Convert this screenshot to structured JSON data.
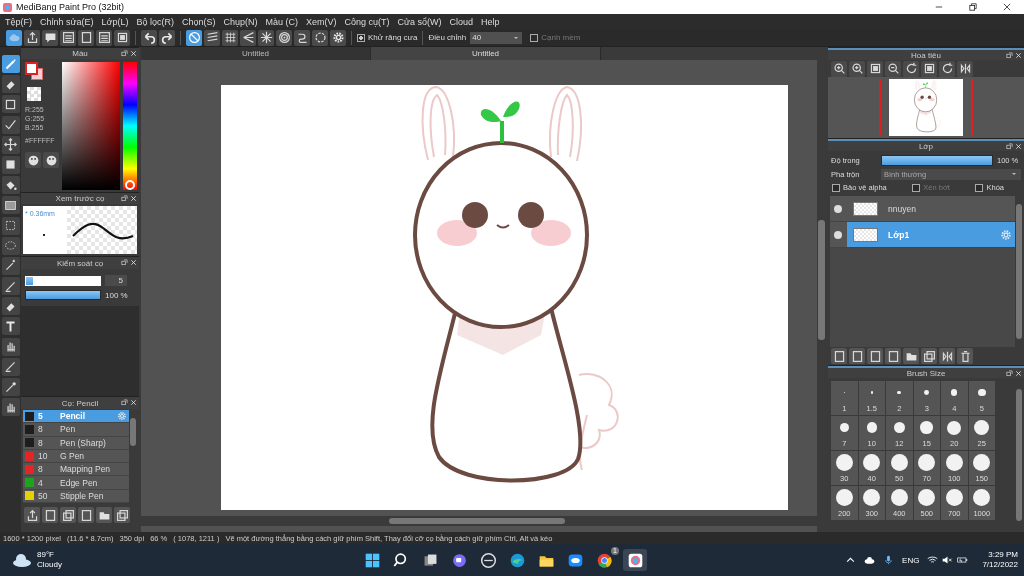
{
  "window": {
    "title": "MediBang Paint Pro (32bit)"
  },
  "menu": [
    "Tệp(F)",
    "Chỉnh sửa(E)",
    "Lớp(L)",
    "Bộ lọc(R)",
    "Chọn(S)",
    "Chụp(N)",
    "Màu (C)",
    "Xem(V)",
    "Công cụ(T)",
    "Cửa sổ(W)",
    "Cloud",
    "Help"
  ],
  "toolbar": {
    "snaps": [
      {
        "selected": true
      },
      {
        "selected": false
      },
      {
        "selected": false
      },
      {
        "selected": false
      },
      {
        "selected": false
      },
      {
        "selected": false
      },
      {
        "selected": false
      },
      {
        "selected": false
      },
      {
        "selected": false
      }
    ],
    "antialias": {
      "label": "Khử răng cưa",
      "checked": true
    },
    "adjust": {
      "label": "Điều chỉnh",
      "value": "40"
    },
    "soft_edge": {
      "label": "Cạnh mềm",
      "checked": false,
      "disabled": true
    }
  },
  "tools": [
    {
      "selected": true
    },
    {
      "selected": false
    },
    {
      "selected": false
    },
    {
      "selected": false
    },
    {
      "selected": false
    },
    {
      "selected": false
    },
    {
      "selected": false
    },
    {
      "selected": false
    },
    {
      "selected": false
    },
    {
      "selected": false
    },
    {
      "selected": false
    },
    {
      "selected": false
    },
    {
      "selected": false
    },
    {
      "selected": false
    },
    {
      "selected": false
    },
    {
      "selected": false
    },
    {
      "selected": false
    },
    {
      "selected": false
    }
  ],
  "color_panel": {
    "title": "Màu",
    "hue": {
      "level": 0
    },
    "r": "R:255",
    "g": "G:255",
    "b": "B:255",
    "hex": "#FFFFFF"
  },
  "brush_preview": {
    "title": "Xem trước cọ",
    "size": "* 0.36mm"
  },
  "brush_control": {
    "title": "Kiểm soát cọ",
    "size": {
      "level": 0.1,
      "value": "5"
    },
    "opacity": {
      "level": 1,
      "value": "100 %"
    }
  },
  "brush_panel": {
    "title": "Cọ: Pencil",
    "brushes": [
      {
        "size": "5",
        "name": "Pencil",
        "color": "#1e1e1e",
        "selected": true
      },
      {
        "size": "8",
        "name": "Pen",
        "color": "#1e1e1e",
        "selected": false
      },
      {
        "size": "8",
        "name": "Pen (Sharp)",
        "color": "#1e1e1e",
        "selected": false
      },
      {
        "size": "10",
        "name": "G Pen",
        "color": "#e52525",
        "selected": false
      },
      {
        "size": "8",
        "name": "Mapping Pen",
        "color": "#e52525",
        "selected": false
      },
      {
        "size": "4",
        "name": "Edge Pen",
        "color": "#1fa31f",
        "selected": false
      },
      {
        "size": "50",
        "name": "Stipple Pen",
        "color": "#e6d200",
        "selected": false
      }
    ]
  },
  "canvas_tabs": [
    {
      "label": "Untitled",
      "selected": false
    },
    {
      "label": "Untitled",
      "selected": true
    }
  ],
  "navigator": {
    "title": "Hoa tiêu"
  },
  "layers": {
    "title": "Lớp",
    "opacity_label": "Độ trong",
    "opacity": {
      "level": 1,
      "value": "100 %"
    },
    "blend_label": "Pha trộn",
    "blend": "Bình thường",
    "options": [
      {
        "label": "Bảo vệ alpha",
        "checked": false,
        "disabled": false
      },
      {
        "label": "Xén bớt",
        "checked": false,
        "disabled": true
      },
      {
        "label": "Khóa",
        "checked": false,
        "disabled": false
      }
    ],
    "items": [
      {
        "name": "nnuyen",
        "selected": false
      },
      {
        "name": "Lớp1",
        "selected": true
      }
    ]
  },
  "brush_size": {
    "title": "Brush Size",
    "sizes": [
      "1",
      "1.5",
      "2",
      "3",
      "4",
      "5",
      "7",
      "10",
      "12",
      "15",
      "20",
      "25",
      "30",
      "40",
      "50",
      "70",
      "100",
      "150",
      "200",
      "300",
      "400",
      "500",
      "700",
      "1000"
    ]
  },
  "status_bar": {
    "size": "1600 * 1200 pixel",
    "physical": "(11.6 * 8.7cm)",
    "dpi": "350 dpi",
    "zoom": "66 %",
    "cursor": "( 1078, 1211 )",
    "hint": "Vẽ một đường thẳng bằng cách giữ phím Shift, Thay đổi cỡ cọ bằng cách giữ phím Ctrl, Alt và kéo"
  },
  "taskbar": {
    "temperature": "89°F",
    "condition": "Cloudy",
    "badge": "1",
    "language": "ENG",
    "time": "3:29 PM",
    "date": "7/12/2022"
  }
}
